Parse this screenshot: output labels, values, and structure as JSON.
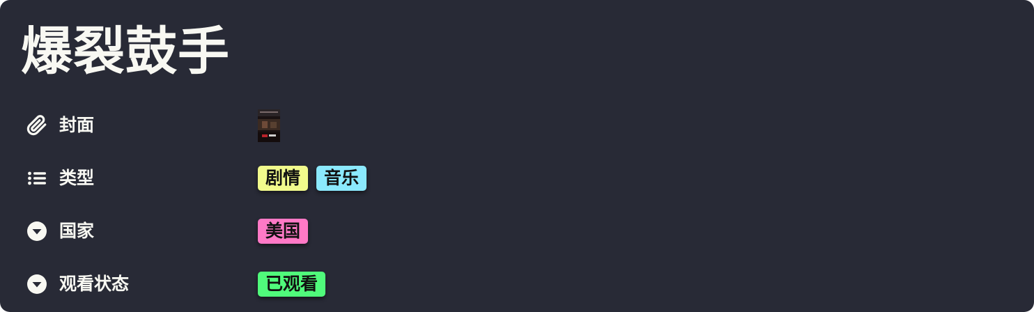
{
  "page": {
    "title": "爆裂鼓手"
  },
  "properties": [
    {
      "icon": "paperclip-icon",
      "label": "封面",
      "type": "file"
    },
    {
      "icon": "list-icon",
      "label": "类型",
      "type": "multi-select",
      "tags": [
        {
          "text": "剧情",
          "color": "#f1fa8c"
        },
        {
          "text": "音乐",
          "color": "#8be9fd"
        }
      ]
    },
    {
      "icon": "select-dropdown-icon",
      "label": "国家",
      "type": "select",
      "tags": [
        {
          "text": "美国",
          "color": "#ff79c6"
        }
      ]
    },
    {
      "icon": "select-dropdown-icon",
      "label": "观看状态",
      "type": "select",
      "tags": [
        {
          "text": "已观看",
          "color": "#50fa7b"
        }
      ]
    }
  ],
  "colors": {
    "background": "#282a36",
    "text": "#f8f8f2"
  }
}
